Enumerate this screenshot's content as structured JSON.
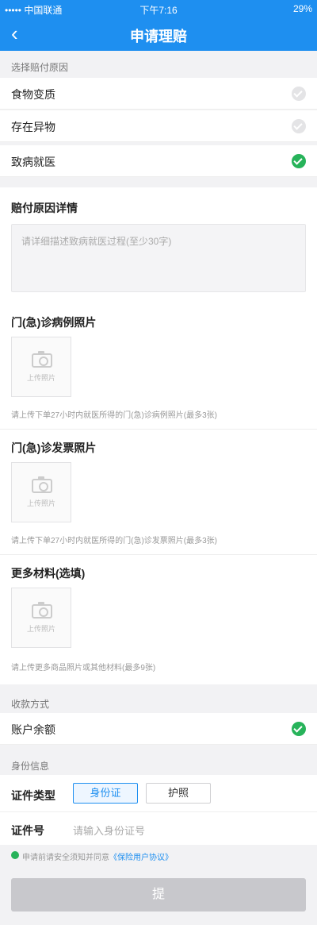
{
  "status_bar": {
    "carrier": "••••• 中国联通",
    "time": "下午7:16",
    "battery": "29%"
  },
  "nav": {
    "back_icon": "chevron-left-icon",
    "title": "申请理赔"
  },
  "reason_section": {
    "label": "选择赔付原因",
    "options": [
      {
        "label": "食物变质",
        "checked": false
      },
      {
        "label": "存在异物",
        "checked": false
      },
      {
        "label": "致病就医",
        "checked": true
      }
    ]
  },
  "detail": {
    "title": "赔付原因详情",
    "placeholder": "请详细描述致病就医过程(至少30字)"
  },
  "uploads": [
    {
      "title": "门(急)诊病例照片",
      "button": "上传照片",
      "hint": "请上传下单27小时内就医所得的门(急)诊病例照片(最多3张)"
    },
    {
      "title": "门(急)诊发票照片",
      "button": "上传照片",
      "hint": "请上传下单27小时内就医所得的门(急)诊发票照片(最多3张)"
    },
    {
      "title": "更多材料(选填)",
      "button": "上传照片",
      "hint": "请上传更多商品照片或其他材料(最多9张)"
    }
  ],
  "payment": {
    "label": "收款方式",
    "option": "账户余额",
    "checked": true
  },
  "identity": {
    "label": "身份信息",
    "type_label": "证件类型",
    "types": [
      "身份证",
      "护照"
    ],
    "active_type": "身份证",
    "number_label": "证件号",
    "number_placeholder": "请输入身份证号"
  },
  "agreement": {
    "text": "申请前请安全须知并同意",
    "link": "《保险用户协议》"
  },
  "submit": {
    "label": "提"
  },
  "colors": {
    "brand": "#1e8ff0",
    "check_on": "#27b35a",
    "check_off": "#e4e4e6"
  }
}
